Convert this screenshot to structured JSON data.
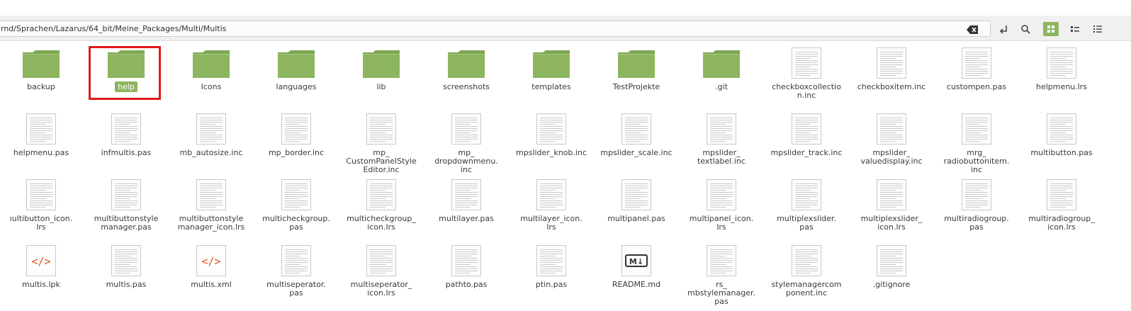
{
  "path": "rnd/Sprachen/Lazarus/64_bit/Meine_Packages/Multi/Multis",
  "toolbar": {
    "clear_icon": "backspace-icon",
    "go_icon": "open-location-icon",
    "search_icon": "search-icon",
    "icon_view_icon": "grid-view-icon",
    "compact_view_icon": "compact-list-icon",
    "list_view_icon": "list-view-icon"
  },
  "colors": {
    "folder": "#8db55f",
    "selection": "#8db55f",
    "highlight_frame": "#e21a1a",
    "accent_code": "#e8501a"
  },
  "items": [
    {
      "label": "backup",
      "type": "folder"
    },
    {
      "label": "help",
      "type": "folder",
      "selected": true
    },
    {
      "label": "Icons",
      "type": "folder"
    },
    {
      "label": "languages",
      "type": "folder"
    },
    {
      "label": "lib",
      "type": "folder"
    },
    {
      "label": "screenshots",
      "type": "folder"
    },
    {
      "label": "templates",
      "type": "folder"
    },
    {
      "label": "TestProjekte",
      "type": "folder"
    },
    {
      "label": ".git",
      "type": "folder"
    },
    {
      "label": "checkboxcollectio\nn.inc",
      "type": "text"
    },
    {
      "label": "checkboxitem.inc",
      "type": "text"
    },
    {
      "label": "custompen.pas",
      "type": "text"
    },
    {
      "label": "helpmenu.lrs",
      "type": "text"
    },
    {
      "label": "helpmenu.pas",
      "type": "text"
    },
    {
      "label": "infmultis.pas",
      "type": "text"
    },
    {
      "label": "mb_autosize.inc",
      "type": "text"
    },
    {
      "label": "mp_border.inc",
      "type": "text"
    },
    {
      "label": "mp_\nCustomPanelStyle\nEditor.inc",
      "type": "text"
    },
    {
      "label": "mp_\ndropdownmenu.\ninc",
      "type": "text"
    },
    {
      "label": "mpslider_knob.inc",
      "type": "text"
    },
    {
      "label": "mpslider_scale.inc",
      "type": "text"
    },
    {
      "label": "mpslider_\ntextlabel.inc",
      "type": "text"
    },
    {
      "label": "mpslider_track.inc",
      "type": "text"
    },
    {
      "label": "mpslider_\nvaluedisplay.inc",
      "type": "text"
    },
    {
      "label": "mrg_\nradiobuttonitem.\ninc",
      "type": "text"
    },
    {
      "label": "multibutton.pas",
      "type": "text"
    },
    {
      "label": "ıultibutton_icon.\nlrs",
      "type": "text"
    },
    {
      "label": "multibuttonstyle\nmanager.pas",
      "type": "text"
    },
    {
      "label": "multibuttonstyle\nmanager_icon.lrs",
      "type": "text"
    },
    {
      "label": "multicheckgroup.\npas",
      "type": "text"
    },
    {
      "label": "multicheckgroup_\nicon.lrs",
      "type": "text"
    },
    {
      "label": "multilayer.pas",
      "type": "text"
    },
    {
      "label": "multilayer_icon.\nlrs",
      "type": "text"
    },
    {
      "label": "multipanel.pas",
      "type": "text"
    },
    {
      "label": "multipanel_icon.\nlrs",
      "type": "text"
    },
    {
      "label": "multiplexslider.\npas",
      "type": "text"
    },
    {
      "label": "multiplexslider_\nicon.lrs",
      "type": "text"
    },
    {
      "label": "multiradiogroup.\npas",
      "type": "text"
    },
    {
      "label": "multiradiogroup_\nicon.lrs",
      "type": "text"
    },
    {
      "label": "multis.lpk",
      "type": "code",
      "glyph": "</>"
    },
    {
      "label": "multis.pas",
      "type": "text"
    },
    {
      "label": "multis.xml",
      "type": "code",
      "glyph": "</>"
    },
    {
      "label": "multiseperator.\npas",
      "type": "text"
    },
    {
      "label": "multiseperator_\nicon.lrs",
      "type": "text"
    },
    {
      "label": "pathto.pas",
      "type": "text"
    },
    {
      "label": "ptin.pas",
      "type": "text"
    },
    {
      "label": "README.md",
      "type": "markdown",
      "glyph": "M↓"
    },
    {
      "label": "rs_\nmbstylemanager.\npas",
      "type": "text"
    },
    {
      "label": "stylemanagercom\nponent.inc",
      "type": "text"
    },
    {
      "label": ".gitignore",
      "type": "text"
    }
  ]
}
